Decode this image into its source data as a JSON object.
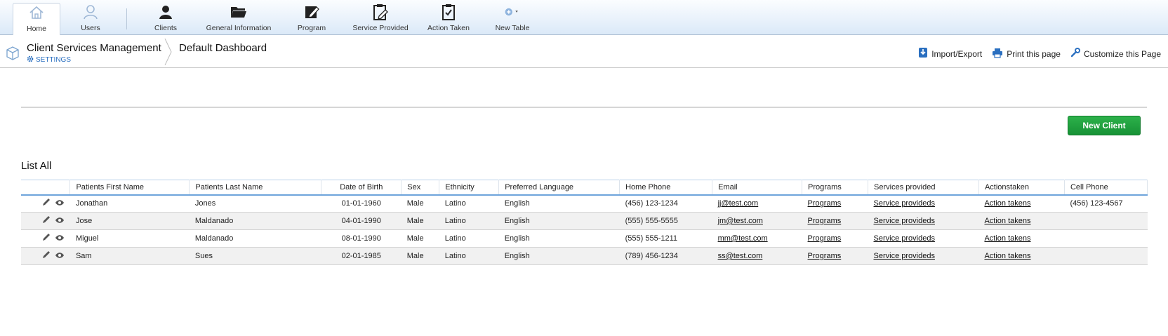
{
  "toolbar": {
    "items": [
      {
        "label": "Home",
        "icon": "home-icon"
      },
      {
        "label": "Users",
        "icon": "user-icon"
      },
      {
        "label": "Clients",
        "icon": "person-icon"
      },
      {
        "label": "General Information",
        "icon": "folder-icon"
      },
      {
        "label": "Program",
        "icon": "edit-note-icon"
      },
      {
        "label": "Service Provided",
        "icon": "clipboard-edit-icon"
      },
      {
        "label": "Action Taken",
        "icon": "clipboard-check-icon"
      },
      {
        "label": "New Table",
        "icon": "add-table-icon"
      }
    ]
  },
  "header": {
    "app_title": "Client Services Management",
    "settings_label": "SETTINGS",
    "dashboard_title": "Default Dashboard",
    "actions": {
      "import_export": "Import/Export",
      "print": "Print this page",
      "customize": "Customize this Page"
    }
  },
  "main": {
    "new_client_label": "New Client",
    "list_title": "List All",
    "table": {
      "columns": [
        "Patients First Name",
        "Patients Last Name",
        "Date of Birth",
        "Sex",
        "Ethnicity",
        "Preferred Language",
        "Home Phone",
        "Email",
        "Programs",
        "Services provided",
        "Actionstaken",
        "Cell Phone"
      ],
      "rows": [
        {
          "first": "Jonathan",
          "last": "Jones",
          "dob": "01-01-1960",
          "sex": "Male",
          "ethnicity": "Latino",
          "language": "English",
          "home_phone": "(456) 123-1234",
          "email": "jj@test.com",
          "programs": "Programs",
          "services": "Service provideds",
          "actions": "Action takens",
          "cell": "(456) 123-4567"
        },
        {
          "first": "Jose",
          "last": "Maldanado",
          "dob": "04-01-1990",
          "sex": "Male",
          "ethnicity": "Latino",
          "language": "English",
          "home_phone": "(555) 555-5555",
          "email": "jm@test.com",
          "programs": "Programs",
          "services": "Service provideds",
          "actions": "Action takens",
          "cell": ""
        },
        {
          "first": "Miguel",
          "last": "Maldanado",
          "dob": "08-01-1990",
          "sex": "Male",
          "ethnicity": "Latino",
          "language": "English",
          "home_phone": "(555) 555-1211",
          "email": "mm@test.com",
          "programs": "Programs",
          "services": "Service provideds",
          "actions": "Action takens",
          "cell": ""
        },
        {
          "first": "Sam",
          "last": "Sues",
          "dob": "02-01-1985",
          "sex": "Male",
          "ethnicity": "Latino",
          "language": "English",
          "home_phone": "(789) 456-1234",
          "email": "ss@test.com",
          "programs": "Programs",
          "services": "Service provideds",
          "actions": "Action takens",
          "cell": ""
        }
      ]
    }
  },
  "colors": {
    "accent": "#2a6fc0",
    "primary_button": "#1f9e3e",
    "header_rule": "#6ea4db"
  }
}
